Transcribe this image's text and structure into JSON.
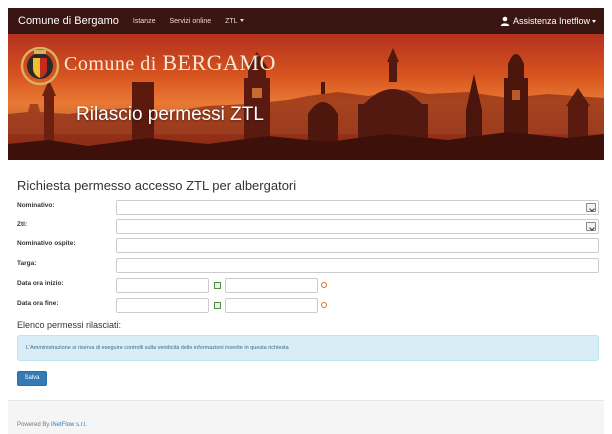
{
  "navbar": {
    "brand": "Comune di Bergamo",
    "links": [
      "Istanze",
      "Servizi online",
      "ZTL"
    ],
    "user": "Assistenza Inetflow"
  },
  "banner": {
    "municipality_prefix": "Comune di ",
    "municipality_name": "BERGAMO",
    "title": "Rilascio permessi ZTL"
  },
  "form": {
    "title": "Richiesta permesso accesso ZTL per albergatori",
    "labels": {
      "nominativo": "Nominativo:",
      "ztl": "Ztl:",
      "ospite": "Nominativo ospite:",
      "targa": "Targa:",
      "inizio": "Data ora inizio:",
      "fine": "Data ora fine:"
    },
    "values": {
      "nominativo": "",
      "ztl": "",
      "ospite": "",
      "targa": "",
      "inizio_data": "",
      "inizio_ora": "",
      "fine_data": "",
      "fine_ora": ""
    },
    "section": "Elenco permessi rilasciati:",
    "alert": "L'Amministrazione si riserva di eseguire controlli sulla veridicità delle informazioni inserite in questa richiesta",
    "save": "Salva"
  },
  "footer": {
    "powered": "Powered By ",
    "company": "iNetFlow s.r.l."
  },
  "colors": {
    "navbar": "#3a1613",
    "primary": "#337ab7",
    "alert_bg": "#d9edf7",
    "alert_text": "#31708f"
  },
  "icons": {
    "user": "user-icon",
    "calendar": "calendar-icon",
    "clock": "clock-icon",
    "dropdown": "chevron-down-icon",
    "coat_of_arms": "coat-of-arms-icon"
  }
}
